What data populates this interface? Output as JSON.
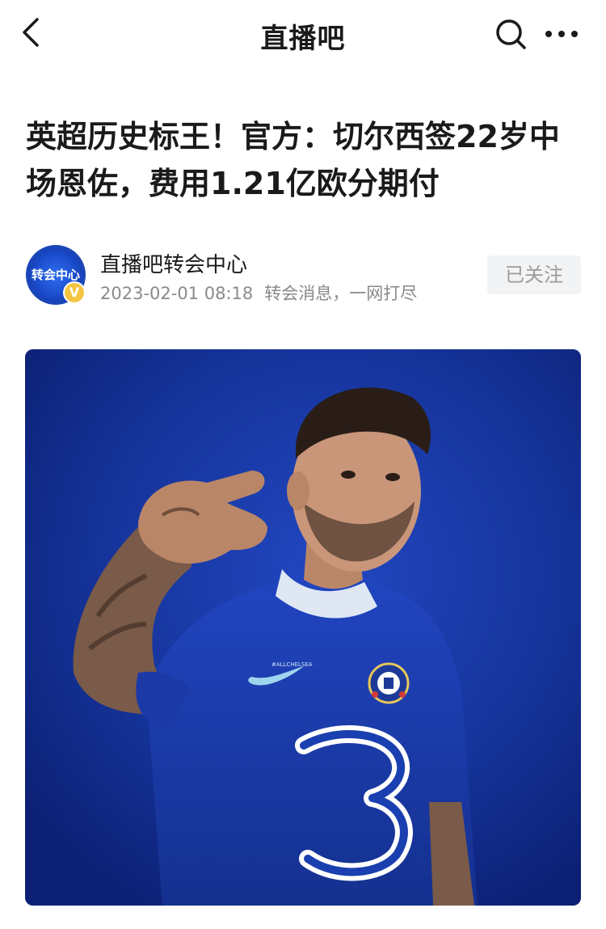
{
  "header": {
    "title": "直播吧",
    "back_icon": "chevron-left-icon",
    "search_icon": "search-icon",
    "more_icon": "more-horizontal-icon"
  },
  "article": {
    "headline": "英超历史标王！官方：切尔西签22岁中场恩佐，费用1.21亿欧分期付"
  },
  "author": {
    "avatar_text": "转会中心",
    "name": "直播吧转会中心",
    "timestamp": "2023-02-01 08:18",
    "tagline": "转会消息，一网打尽",
    "follow_label": "已关注",
    "verified_mark": "V"
  },
  "image": {
    "alt": "Chelsea player in blue home kit pointing at camera",
    "shirt_sponsor": "3",
    "collar_text": "#ALLCHELSEA",
    "crest_text": "CHELSEA"
  },
  "colors": {
    "background": "#ffffff",
    "text_primary": "#1a1a1a",
    "text_secondary": "#8a8a8a",
    "follow_bg": "#f2f3f5",
    "image_blue": "#142f97",
    "kit_blue": "#1a3fb0"
  }
}
